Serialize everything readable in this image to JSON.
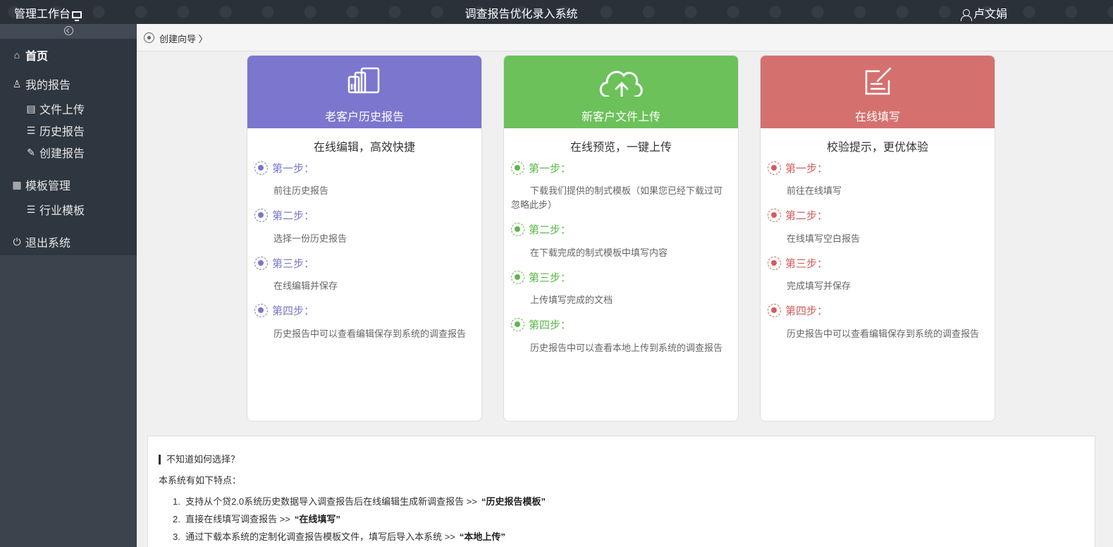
{
  "topbar": {
    "brand": "管理工作台",
    "title": "调查报告优化录入系统",
    "user": "卢文娟"
  },
  "sidebar": {
    "items": [
      {
        "label": "首页",
        "icon": "home-icon"
      },
      {
        "label": "我的报告",
        "icon": "user-icon"
      },
      {
        "label": "文件上传",
        "icon": "file-icon"
      },
      {
        "label": "历史报告",
        "icon": "list-icon"
      },
      {
        "label": "创建报告",
        "icon": "edit-icon"
      },
      {
        "label": "模板管理",
        "icon": "template-icon"
      },
      {
        "label": "行业模板",
        "icon": "list-icon"
      },
      {
        "label": "退出系统",
        "icon": "power-icon"
      }
    ]
  },
  "breadcrumb": {
    "label": "创建向导"
  },
  "cards": [
    {
      "title": "老客户历史报告",
      "subtitle": "在线编辑，高效快捷",
      "color": "#7b76ce",
      "icon": "copy-files-icon",
      "steps": [
        {
          "label": "第一步：",
          "desc": "前往历史报告"
        },
        {
          "label": "第二步：",
          "desc": "选择一份历史报告"
        },
        {
          "label": "第三步：",
          "desc": "在线编辑并保存"
        },
        {
          "label": "第四步：",
          "desc": "历史报告中可以查看编辑保存到系统的调查报告"
        }
      ]
    },
    {
      "title": "新客户文件上传",
      "subtitle": "在线预览，一键上传",
      "color": "#6cc15a",
      "icon": "cloud-upload-icon",
      "steps": [
        {
          "label": "第一步：",
          "desc": "下载我们提供的制式模板（如果您已经下载过可忽略此步）"
        },
        {
          "label": "第二步：",
          "desc": "在下载完成的制式模板中填写内容"
        },
        {
          "label": "第三步：",
          "desc": "上传填写完成的文档"
        },
        {
          "label": "第四步：",
          "desc": "历史报告中可以查看本地上传到系统的调查报告"
        }
      ]
    },
    {
      "title": "在线填写",
      "subtitle": "校验提示，更优体验",
      "color": "#d4716f",
      "icon": "edit-form-icon",
      "steps": [
        {
          "label": "第一步：",
          "desc": "前往在线填写"
        },
        {
          "label": "第二步：",
          "desc": "在线填写空白报告"
        },
        {
          "label": "第三步：",
          "desc": "完成填写并保存"
        },
        {
          "label": "第四步：",
          "desc": "历史报告中可以查看编辑保存到系统的调查报告"
        }
      ]
    }
  ],
  "info": {
    "heading": "不知道如何选择？",
    "intro": "本系统有如下特点：",
    "features": [
      {
        "num": "1.",
        "text": "支持从个贷2.0系统历史数据导入调查报告后在线编辑生成新调查报告 >>",
        "link": "“历史报告模板”"
      },
      {
        "num": "2.",
        "text": "直接在线填写调查报告 >>",
        "link": "“在线填写”"
      },
      {
        "num": "3.",
        "text": "通过下载本系统的定制化调查报告模板文件，填写后导入本系统 >>",
        "link": "“本地上传”"
      }
    ]
  }
}
